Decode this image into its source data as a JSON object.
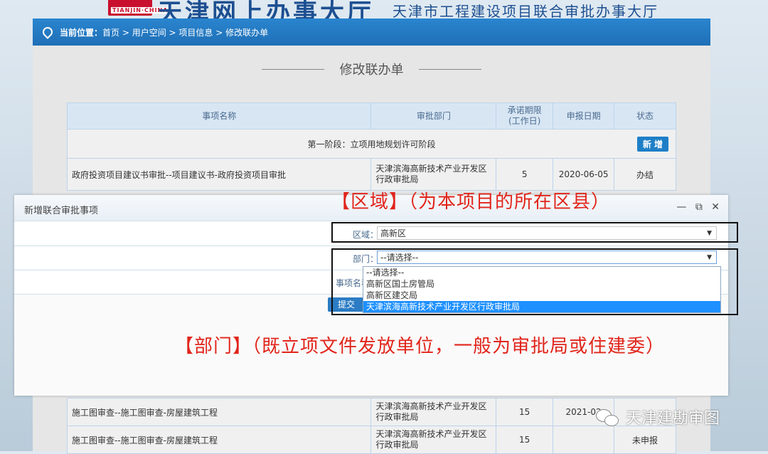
{
  "banner": {
    "logo_sub": "TIANJIN·CHINA",
    "title": "天津网上办事大厅",
    "subtitle": "天津市工程建设项目联合审批办事大厅"
  },
  "breadcrumb": {
    "prefix": "当前位置：",
    "path": "首页 > 用户空间 > 项目信息 > 修改联办单"
  },
  "page_title": "修改联办单",
  "table": {
    "headers": [
      "事项名称",
      "审批部门",
      "承诺期限\n(工作日)",
      "申报日期",
      "状态"
    ],
    "stage_label": "第一阶段：立项用地规划许可阶段",
    "add_label": "新 增",
    "rows": [
      {
        "name": "政府投资项目建议书审批--项目建议书-政府投资项目审批",
        "dept": "天津滨海高新技术产业开发区行政审批局",
        "days": "5",
        "date": "2020-06-05",
        "status": "办结"
      }
    ],
    "lower_rows": [
      {
        "name": "施工图审查--施工图审查-房屋建筑工程",
        "dept": "天津滨海高新技术产业开发区行政审批局",
        "days": "15",
        "date": "2021-02",
        "status": ""
      },
      {
        "name": "施工图审查--施工图审查-房屋建筑工程",
        "dept": "天津滨海高新技术产业开发区行政审批局",
        "days": "15",
        "date": "",
        "status": "未申报"
      }
    ]
  },
  "modal": {
    "title": "新增联合审批事项",
    "controls": {
      "minimize": "—",
      "maximize": "⧉",
      "close": "✕"
    },
    "region_label": "区域：",
    "region_value": "高新区",
    "dept_label": "部门：",
    "dept_value": "--请选择--",
    "item_label": "事项名称：",
    "submit_label": "提交",
    "dept_options": [
      "--请选择--",
      "高新区国土房管局",
      "高新区建交局",
      "天津滨海高新技术产业开发区行政审批局"
    ]
  },
  "annotations": {
    "region": "【区域】（为本项目的所在区县）",
    "dept": "【部门】（既立项文件发放单位，一般为审批局或住建委）"
  },
  "watermark": "天津建勘审图"
}
